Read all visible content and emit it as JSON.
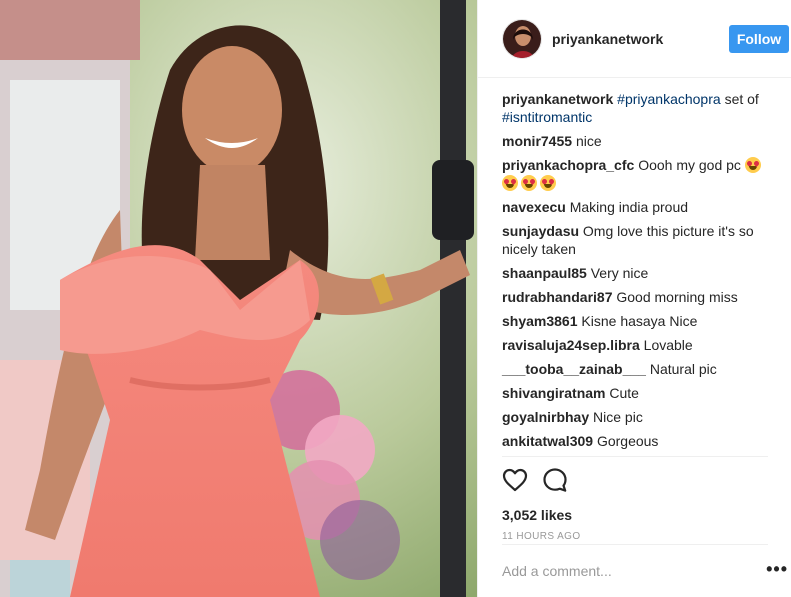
{
  "post": {
    "username": "priyankanetwork",
    "follow_label": "Follow",
    "caption": {
      "username": "priyankanetwork",
      "tags": [
        "#priyankachopra",
        "#isntitromantic"
      ],
      "text": "set of"
    },
    "comments": [
      {
        "user": "monir7455",
        "text": "nice"
      },
      {
        "user": "priyankachopra_cfc",
        "text": "Oooh my god pc",
        "emoji_count": 4
      },
      {
        "user": "navexecu",
        "text": "Making india proud"
      },
      {
        "user": "sunjaydasu",
        "text": "Omg love this picture it's so nicely taken"
      },
      {
        "user": "shaanpaul85",
        "text": "Very nice"
      },
      {
        "user": "rudrabhandari87",
        "text": "Good morning miss"
      },
      {
        "user": "shyam3861",
        "text": "Kisne hasaya Nice"
      },
      {
        "user": "ravisaluja24sep.libra",
        "text": "Lovable"
      },
      {
        "user": "___tooba__zainab___",
        "text": "Natural pic"
      },
      {
        "user": "shivangiratnam",
        "text": "Cute"
      },
      {
        "user": "goyalnirbhay",
        "text": "Nice pic"
      },
      {
        "user": "ankitatwal309",
        "text": "Gorgeous"
      }
    ],
    "likes": "3,052 likes",
    "timestamp": "11 HOURS AGO",
    "add_comment_placeholder": "Add a comment...",
    "more_options": "•••"
  },
  "icons": {
    "like": "heart-icon",
    "comment": "comment-bubble-icon",
    "more": "more-options-icon",
    "emoji": "heart-eyes-emoji-icon"
  },
  "colors": {
    "follow_button": "#3897f0",
    "hashtag": "#003569",
    "muted": "#999999",
    "text": "#262626",
    "border": "#efefef"
  }
}
